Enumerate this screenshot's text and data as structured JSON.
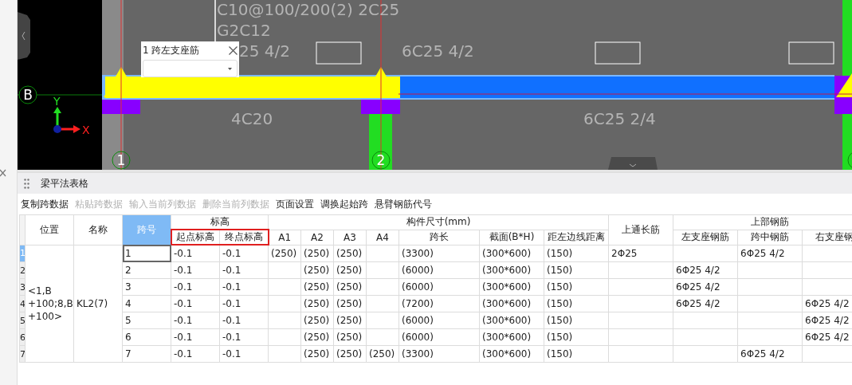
{
  "canvas": {
    "annotations": [
      "C10@100/200(2) 2C25",
      "G2C12",
      "25 4/2",
      "6C25 4/2",
      "4C20",
      "6C25 2/4"
    ],
    "axis_labels": [
      "B",
      "1",
      "2"
    ],
    "axis_letters": [
      "Y",
      "X"
    ],
    "popup": {
      "title": "1 跨左支座筋"
    }
  },
  "panel": {
    "title": "梁平法表格"
  },
  "toolbar": [
    {
      "label": "复制跨数据",
      "disabled": false
    },
    {
      "label": "粘贴跨数据",
      "disabled": true
    },
    {
      "label": "输入当前列数据",
      "disabled": true
    },
    {
      "label": "删除当前列数据",
      "disabled": true
    },
    {
      "label": "页面设置",
      "disabled": false
    },
    {
      "label": "调换起始跨",
      "disabled": false
    },
    {
      "label": "悬臂钢筋代号",
      "disabled": false
    }
  ],
  "table": {
    "columns": [
      {
        "label": "位置",
        "selected": false
      },
      {
        "label": "名称",
        "selected": false
      },
      {
        "label": "跨号",
        "selected": true
      },
      {
        "label": "标高",
        "outlined": true,
        "children": [
          {
            "label": "起点标高",
            "selected": false
          },
          {
            "label": "终点标高",
            "selected": false
          }
        ]
      },
      {
        "label": "构件尺寸(mm)",
        "outlined": false,
        "children": [
          {
            "label": "A1",
            "selected": false
          },
          {
            "label": "A2",
            "selected": false
          },
          {
            "label": "A3",
            "selected": false
          },
          {
            "label": "A4",
            "selected": false
          },
          {
            "label": "跨长",
            "selected": false
          },
          {
            "label": "截面(B*H)",
            "selected": false
          },
          {
            "label": "距左边线距离",
            "selected": false
          }
        ]
      },
      {
        "label": "上通长筋",
        "selected": false
      },
      {
        "label": "上部钢筋",
        "outlined": false,
        "children": [
          {
            "label": "左支座钢筋",
            "selected": false
          },
          {
            "label": "跨中钢筋",
            "selected": false
          },
          {
            "label": "右支座钢",
            "selected": false
          }
        ]
      }
    ],
    "position": "<1,B +100;8,B +100>",
    "name": "KL2(7)",
    "rows": [
      {
        "number": "1",
        "selected": true,
        "span": "1",
        "start_elevation": "-0.1",
        "end_elevation": "-0.1",
        "a1": "(250)",
        "a2": "(250)",
        "a3": "(250)",
        "span_length": "(3300)",
        "section": "(300*600)",
        "offset": "(150)",
        "top_through": "2Φ25",
        "mid_span": "6Φ25 4/2"
      },
      {
        "number": "2",
        "selected": false,
        "span": "2",
        "start_elevation": "-0.1",
        "end_elevation": "-0.1",
        "a2": "(250)",
        "a3": "(250)",
        "span_length": "(6000)",
        "section": "(300*600)",
        "offset": "(150)",
        "left_support": "6Φ25 4/2"
      },
      {
        "number": "3",
        "selected": false,
        "span": "3",
        "start_elevation": "-0.1",
        "end_elevation": "-0.1",
        "a2": "(250)",
        "a3": "(250)",
        "span_length": "(6000)",
        "section": "(300*600)",
        "offset": "(150)",
        "left_support": "6Φ25 4/2"
      },
      {
        "number": "4",
        "selected": false,
        "span": "4",
        "start_elevation": "-0.1",
        "end_elevation": "-0.1",
        "a2": "(250)",
        "a3": "(250)",
        "span_length": "(7200)",
        "section": "(300*600)",
        "offset": "(150)",
        "left_support": "6Φ25 4/2",
        "right_support": "6Φ25 4/2"
      },
      {
        "number": "5",
        "selected": false,
        "span": "5",
        "start_elevation": "-0.1",
        "end_elevation": "-0.1",
        "a2": "(250)",
        "a3": "(250)",
        "span_length": "(6000)",
        "section": "(300*600)",
        "offset": "(150)",
        "right_support": "6Φ25 4/2"
      },
      {
        "number": "6",
        "selected": false,
        "span": "6",
        "start_elevation": "-0.1",
        "end_elevation": "-0.1",
        "a2": "(250)",
        "a3": "(250)",
        "span_length": "(6000)",
        "section": "(300*600)",
        "offset": "(150)",
        "right_support": "6Φ25 4/2"
      },
      {
        "number": "7",
        "selected": false,
        "span": "7",
        "start_elevation": "-0.1",
        "end_elevation": "-0.1",
        "a2": "(250)",
        "a3": "(250)",
        "a4": "(250)",
        "span_length": "(3300)",
        "section": "(300*600)",
        "offset": "(150)",
        "mid_span": "6Φ25 4/2"
      }
    ]
  }
}
